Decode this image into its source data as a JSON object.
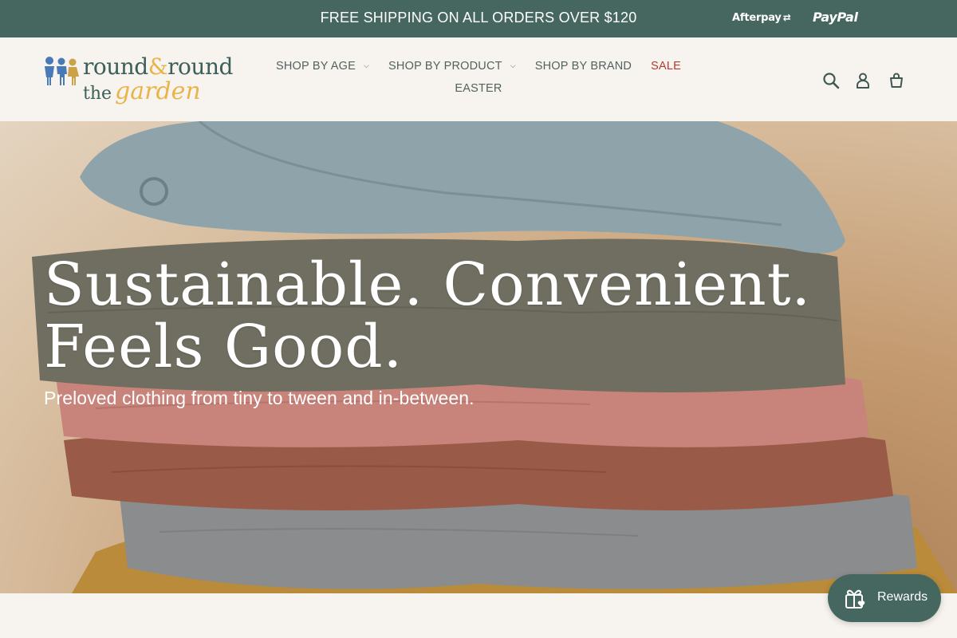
{
  "announcement": {
    "text": "FREE SHIPPING ON ALL ORDERS OVER $120",
    "payments": [
      "Afterpay",
      "PayPal"
    ]
  },
  "brand": {
    "line1_a": "round",
    "line1_amp": "&",
    "line1_b": "round",
    "line2_a": "the",
    "line2_b": "garden"
  },
  "nav": {
    "row1": [
      {
        "label": "SHOP BY AGE",
        "has_dropdown": true
      },
      {
        "label": "SHOP BY PRODUCT",
        "has_dropdown": true
      },
      {
        "label": "SHOP BY BRAND",
        "has_dropdown": false
      },
      {
        "label": "SALE",
        "has_dropdown": false
      }
    ],
    "row2": [
      {
        "label": "EASTER",
        "has_dropdown": false
      }
    ]
  },
  "header_icons": [
    "search-icon",
    "account-icon",
    "cart-icon"
  ],
  "hero": {
    "title_line1": "Sustainable. Convenient.",
    "title_line2": "Feels Good.",
    "subtitle": "Preloved clothing from tiny to tween and in-between."
  },
  "rewards": {
    "label": "Rewards"
  },
  "colors": {
    "announcement_bg": "#46675f",
    "header_bg": "#f7f3ee",
    "sale_text": "#b43a32",
    "logo_teal": "#3d5f5a",
    "logo_gold": "#e8b54a"
  }
}
